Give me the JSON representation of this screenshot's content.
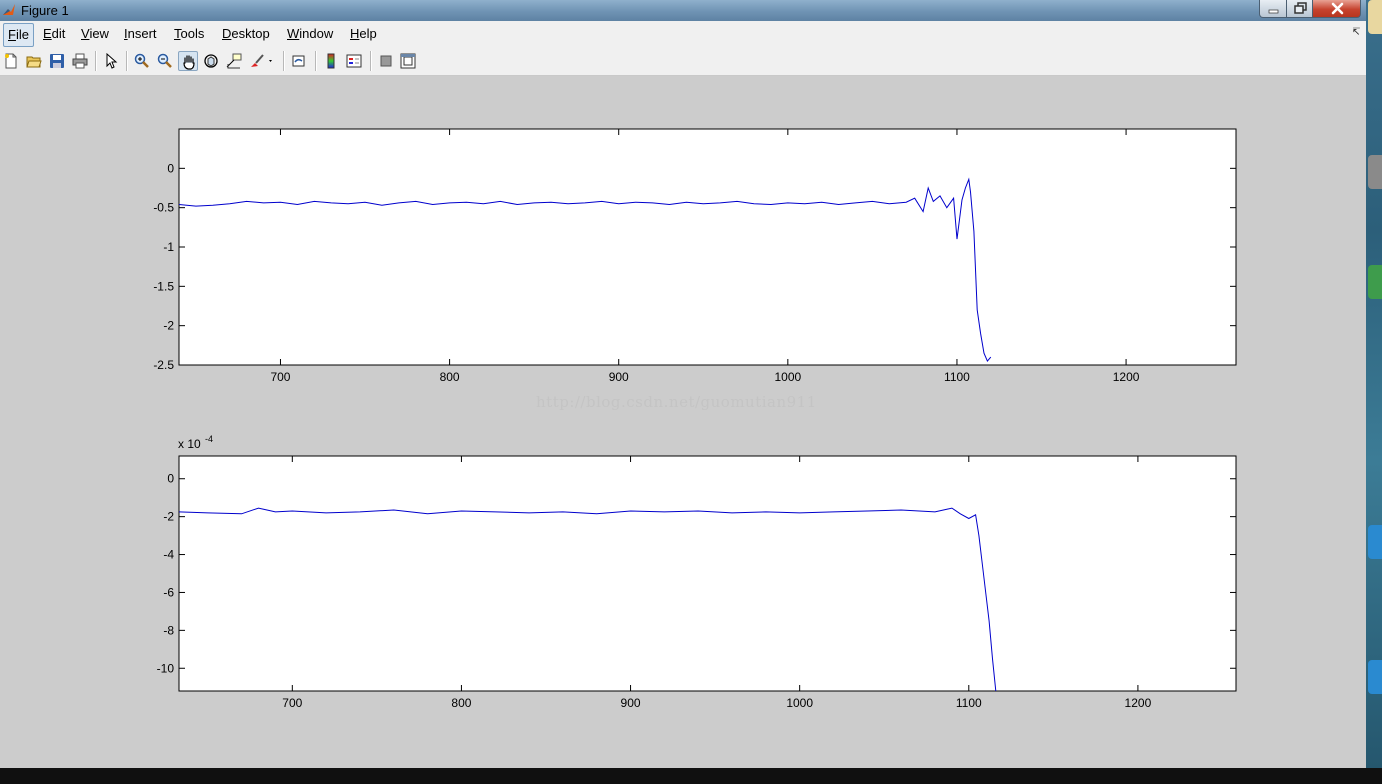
{
  "window": {
    "title": "Figure 1"
  },
  "menu": {
    "items": [
      {
        "key": "file",
        "acc": "F",
        "rest": "ile"
      },
      {
        "key": "edit",
        "acc": "E",
        "rest": "dit"
      },
      {
        "key": "view",
        "acc": "V",
        "rest": "iew"
      },
      {
        "key": "insert",
        "acc": "I",
        "rest": "nsert"
      },
      {
        "key": "tools",
        "acc": "T",
        "rest": "ools"
      },
      {
        "key": "desktop",
        "acc": "D",
        "rest": "esktop"
      },
      {
        "key": "window",
        "acc": "W",
        "rest": "indow"
      },
      {
        "key": "help",
        "acc": "H",
        "rest": "elp"
      }
    ]
  },
  "toolbar": {
    "buttons": [
      "new-figure-icon",
      "open-file-icon",
      "save-icon",
      "print-icon",
      "edit-plot-arrow-icon",
      "zoom-in-icon",
      "zoom-out-icon",
      "pan-hand-icon",
      "rotate-3d-icon",
      "data-cursor-icon",
      "brush-icon",
      "link-plot-icon",
      "colorbar-icon",
      "legend-icon",
      "hide-plot-tools-icon",
      "show-plot-tools-icon"
    ],
    "active": "pan-hand-icon"
  },
  "watermark": "http://blog.csdn.net/guomutian911",
  "colors": {
    "line": "#0000cc",
    "figure_bg": "#cccccc",
    "axes_bg": "#ffffff"
  },
  "chart_data": [
    {
      "type": "line",
      "title": "",
      "xlabel": "",
      "ylabel": "",
      "xlim": [
        640,
        1265
      ],
      "ylim": [
        -2.5,
        0.5
      ],
      "xticks": [
        700,
        800,
        900,
        1000,
        1100,
        1200
      ],
      "yticks": [
        0,
        -0.5,
        -1,
        -1.5,
        -2,
        -2.5
      ],
      "ytick_labels": [
        "0",
        "-0.5",
        "-1",
        "-1.5",
        "-2",
        "-2.5"
      ],
      "grid": false,
      "series": [
        {
          "x": [
            640,
            650,
            660,
            670,
            680,
            690,
            700,
            710,
            720,
            730,
            740,
            750,
            760,
            770,
            780,
            790,
            800,
            810,
            820,
            830,
            840,
            850,
            860,
            870,
            880,
            890,
            900,
            910,
            920,
            930,
            940,
            950,
            960,
            970,
            980,
            990,
            1000,
            1010,
            1020,
            1030,
            1040,
            1050,
            1060,
            1070,
            1075,
            1080,
            1083,
            1086,
            1090,
            1094,
            1098,
            1100,
            1103,
            1105,
            1107,
            1108,
            1110,
            1112,
            1114,
            1116,
            1118,
            1120
          ],
          "y": [
            -0.46,
            -0.48,
            -0.47,
            -0.45,
            -0.42,
            -0.44,
            -0.43,
            -0.46,
            -0.42,
            -0.44,
            -0.45,
            -0.43,
            -0.47,
            -0.44,
            -0.42,
            -0.46,
            -0.44,
            -0.43,
            -0.45,
            -0.42,
            -0.46,
            -0.44,
            -0.43,
            -0.45,
            -0.44,
            -0.42,
            -0.45,
            -0.43,
            -0.44,
            -0.46,
            -0.43,
            -0.45,
            -0.44,
            -0.42,
            -0.45,
            -0.46,
            -0.44,
            -0.45,
            -0.43,
            -0.46,
            -0.44,
            -0.42,
            -0.45,
            -0.43,
            -0.38,
            -0.55,
            -0.25,
            -0.42,
            -0.35,
            -0.5,
            -0.38,
            -0.9,
            -0.4,
            -0.25,
            -0.14,
            -0.3,
            -0.8,
            -1.8,
            -2.1,
            -2.35,
            -2.45,
            -2.4
          ]
        }
      ]
    },
    {
      "type": "line",
      "title": "",
      "xlabel": "",
      "ylabel": "",
      "scale_label": "x 10",
      "scale_exp": "-4",
      "xlim": [
        633,
        1258
      ],
      "ylim": [
        -11.2,
        1.2
      ],
      "xticks": [
        700,
        800,
        900,
        1000,
        1100,
        1200
      ],
      "yticks": [
        0,
        -2,
        -4,
        -6,
        -8,
        -10
      ],
      "ytick_labels": [
        "0",
        "-2",
        "-4",
        "-6",
        "-8",
        "-10"
      ],
      "grid": false,
      "series": [
        {
          "x": [
            633,
            650,
            670,
            680,
            690,
            700,
            720,
            740,
            760,
            780,
            800,
            820,
            840,
            860,
            880,
            900,
            920,
            940,
            960,
            980,
            1000,
            1020,
            1040,
            1060,
            1080,
            1090,
            1095,
            1100,
            1104,
            1106,
            1108,
            1110,
            1112,
            1114,
            1116
          ],
          "y": [
            -1.75,
            -1.8,
            -1.85,
            -1.55,
            -1.75,
            -1.7,
            -1.8,
            -1.75,
            -1.65,
            -1.85,
            -1.7,
            -1.75,
            -1.8,
            -1.75,
            -1.85,
            -1.7,
            -1.75,
            -1.7,
            -1.8,
            -1.75,
            -1.8,
            -1.75,
            -1.7,
            -1.65,
            -1.75,
            -1.55,
            -1.85,
            -2.1,
            -1.9,
            -3.0,
            -4.5,
            -6.0,
            -7.5,
            -9.5,
            -11.2
          ]
        }
      ]
    }
  ]
}
